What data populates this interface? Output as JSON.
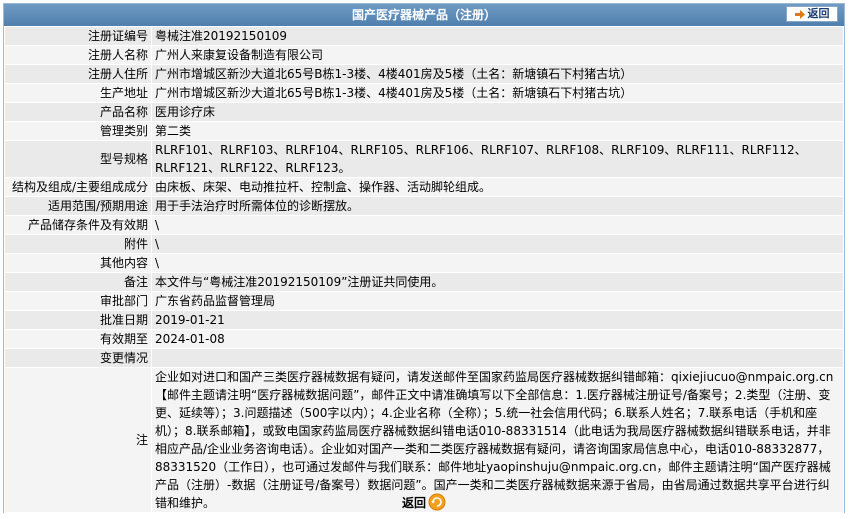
{
  "header": {
    "title": "国产医疗器械产品（注册）",
    "back_label": "返回"
  },
  "rows": [
    {
      "label": "注册证编号",
      "value": "粤械注准20192150109"
    },
    {
      "label": "注册人名称",
      "value": "广州人来康复设备制造有限公司"
    },
    {
      "label": "注册人住所",
      "value": "广州市增城区新沙大道北65号B栋1-3楼、4楼401房及5楼（土名：新塘镇石下村猪古坑）"
    },
    {
      "label": "生产地址",
      "value": "广州市增城区新沙大道北65号B栋1-3楼、4楼401房及5楼（土名：新塘镇石下村猪古坑）"
    },
    {
      "label": "产品名称",
      "value": "医用诊疗床"
    },
    {
      "label": "管理类别",
      "value": "第二类"
    },
    {
      "label": "型号规格",
      "value": "RLRF101、RLRF103、RLRF104、RLRF105、RLRF106、RLRF107、RLRF108、RLRF109、RLRF111、RLRF112、RLRF121、RLRF122、RLRF123。"
    },
    {
      "label": "结构及组成/主要组成成分",
      "value": "由床板、床架、电动推拉杆、控制盒、操作器、活动脚轮组成。"
    },
    {
      "label": "适用范围/预期用途",
      "value": "用于手法治疗时所需体位的诊断摆放。"
    },
    {
      "label": "产品储存条件及有效期",
      "value": "\\"
    },
    {
      "label": "附件",
      "value": "\\"
    },
    {
      "label": "其他内容",
      "value": "\\"
    },
    {
      "label": "备注",
      "value": "本文件与“粤械注准20192150109”注册证共同使用。"
    },
    {
      "label": "审批部门",
      "value": "广东省药品监督管理局"
    },
    {
      "label": "批准日期",
      "value": "2019-01-21"
    },
    {
      "label": "有效期至",
      "value": "2024-01-08"
    },
    {
      "label": "变更情况",
      "value": ""
    }
  ],
  "note": {
    "label": "注",
    "text": "企业如对进口和国产三类医疗器械数据有疑问，请发送邮件至国家药监局医疗器械数据纠错邮箱：qixiejiucuo@nmpaic.org.cn【邮件主题请注明“医疗器械数据问题”，邮件正文中请准确填写以下全部信息：1.医疗器械注册证号/备案号；2.类型（注册、变更、延续等）；3.问题描述（500字以内）；4.企业名称（全称）；5.统一社会信用代码；6.联系人姓名；7.联系电话（手机和座机）；8.联系邮箱】，或致电国家药监局医疗器械数据纠错电话010-88331514（此电话为我局医疗器械数据纠错联系电话，并非相应产品/企业业务咨询电话）。企业如对国产一类和二类医疗器械数据有疑问，请咨询国家局信息中心，电话010-88332877，88331520（工作日），也可通过发邮件与我们联系：邮件地址yaopinshuju@nmpaic.org.cn，邮件主题请注明“国产医疗器械产品（注册）-数据（注册证号/备案号）数据问题”。国产一类和二类医疗器械数据来源于省局，由省局通过数据共享平台进行纠错和维护。"
  },
  "footer": {
    "back_label": "返回"
  }
}
